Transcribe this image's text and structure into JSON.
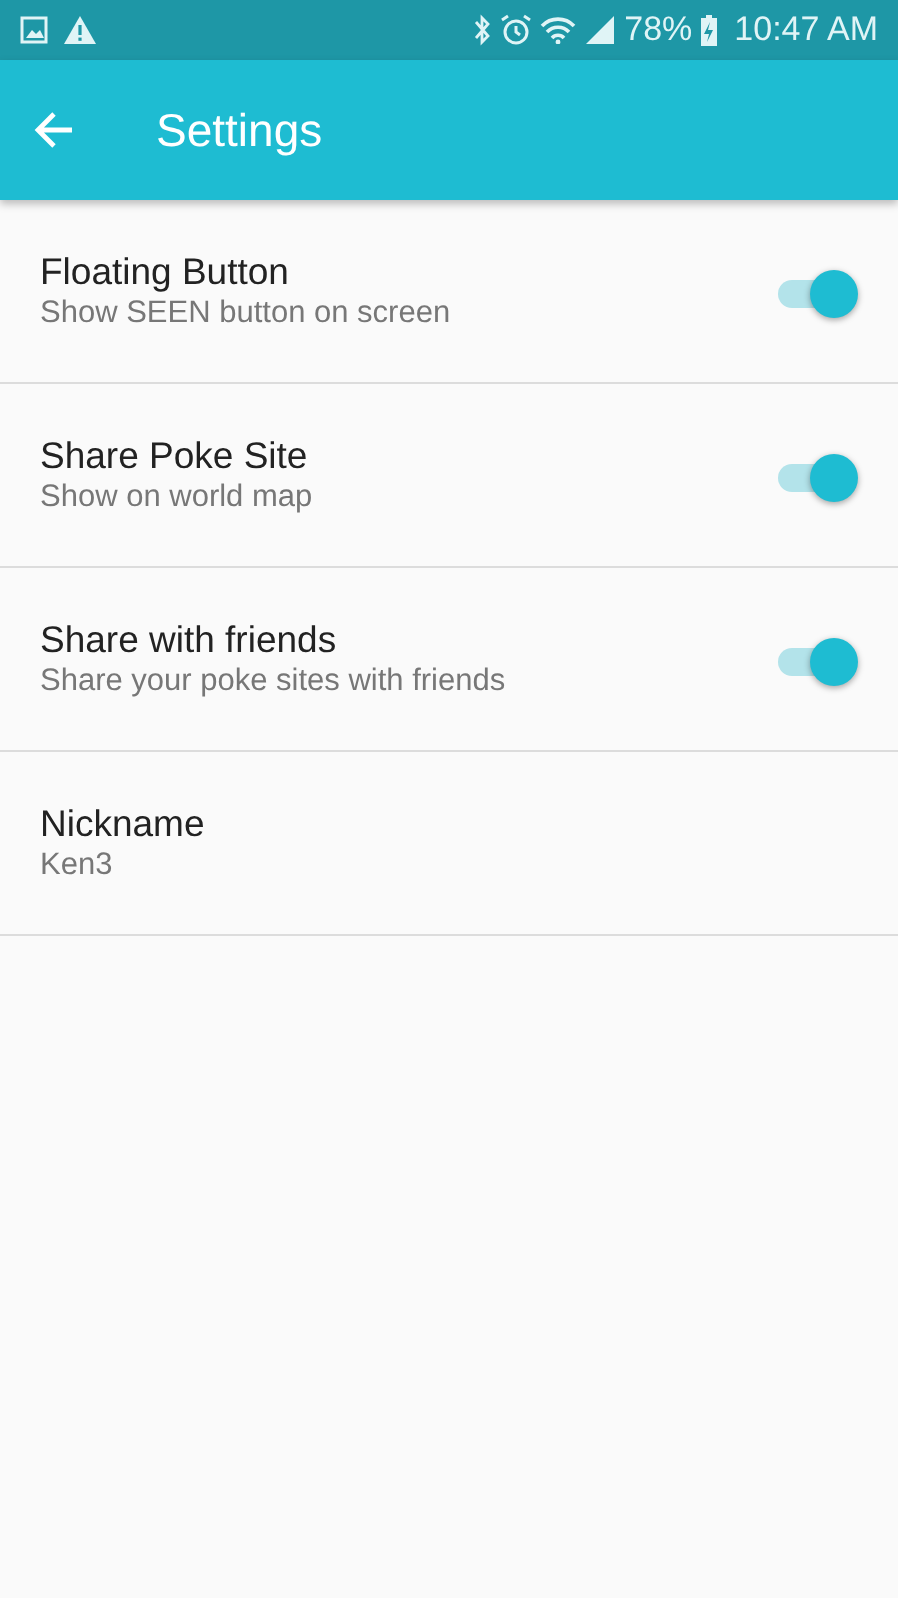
{
  "status_bar": {
    "battery": "78%",
    "time": "10:47 AM"
  },
  "app_bar": {
    "title": "Settings"
  },
  "settings": [
    {
      "kind": "switch",
      "title": "Floating Button",
      "summary": "Show SEEN button on screen",
      "on": true
    },
    {
      "kind": "switch",
      "title": "Share Poke Site",
      "summary": "Show on world map",
      "on": true
    },
    {
      "kind": "switch",
      "title": "Share with friends",
      "summary": "Share your poke sites with friends",
      "on": true
    },
    {
      "kind": "text",
      "title": "Nickname",
      "summary": "Ken3"
    }
  ]
}
